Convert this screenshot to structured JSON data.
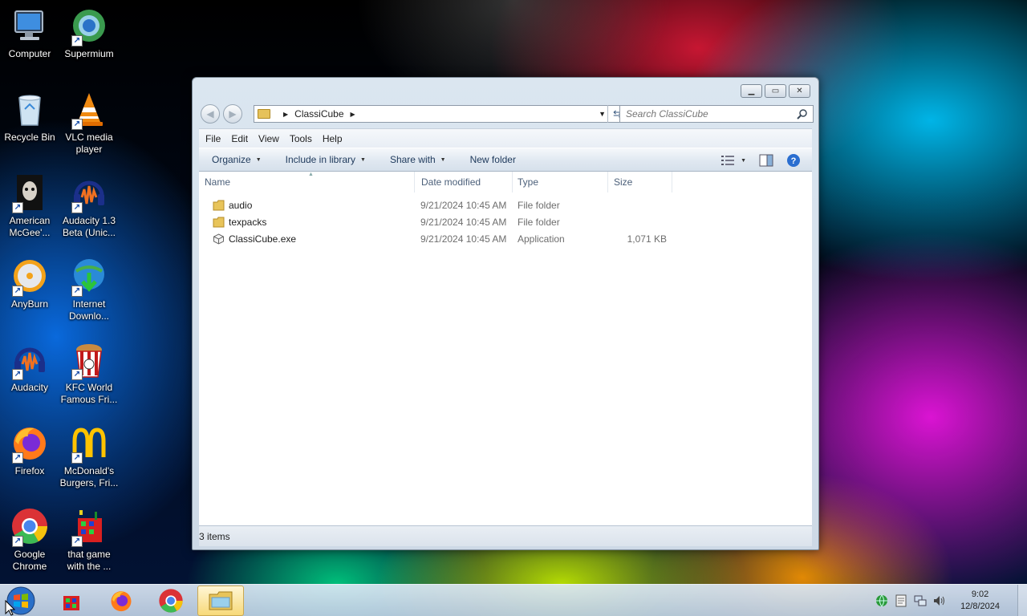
{
  "desktop": {
    "icons": [
      {
        "label": "Computer"
      },
      {
        "label": "Supermium"
      },
      {
        "label": "Recycle Bin"
      },
      {
        "label": "VLC media player"
      },
      {
        "label": "American McGee'..."
      },
      {
        "label": "Audacity 1.3 Beta (Unic..."
      },
      {
        "label": "AnyBurn"
      },
      {
        "label": "Internet Downlo..."
      },
      {
        "label": "Audacity"
      },
      {
        "label": "KFC World Famous Fri..."
      },
      {
        "label": "Firefox"
      },
      {
        "label": "McDonald's Burgers, Fri..."
      },
      {
        "label": "Google Chrome"
      },
      {
        "label": "that game with the ..."
      }
    ]
  },
  "explorer": {
    "breadcrumb": "ClassiCube",
    "search_placeholder": "Search ClassiCube",
    "menu": [
      "File",
      "Edit",
      "View",
      "Tools",
      "Help"
    ],
    "toolbar": {
      "organize": "Organize",
      "include_in_library": "Include in library",
      "share_with": "Share with",
      "new_folder": "New folder"
    },
    "columns": [
      "Name",
      "Date modified",
      "Type",
      "Size"
    ],
    "files": [
      {
        "name": "audio",
        "date": "9/21/2024 10:45 AM",
        "type": "File folder",
        "size": "",
        "icon": "folder-icon"
      },
      {
        "name": "texpacks",
        "date": "9/21/2024 10:45 AM",
        "type": "File folder",
        "size": "",
        "icon": "folder-icon"
      },
      {
        "name": "ClassiCube.exe",
        "date": "9/21/2024 10:45 AM",
        "type": "Application",
        "size": "1,071 KB",
        "icon": "application-icon"
      }
    ],
    "status": "3 items"
  },
  "taskbar": {
    "apps": [
      "start-orb",
      "that-game-icon",
      "firefox-icon",
      "chrome-icon",
      "explorer-icon"
    ],
    "active_app": "explorer-icon",
    "clock_time": "9:02",
    "clock_date": "12/8/2024"
  }
}
